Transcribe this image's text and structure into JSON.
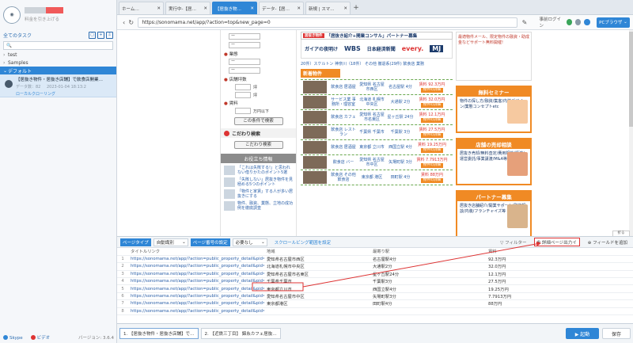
{
  "sidebar": {
    "brand_sub": "料金を引き上げる",
    "all_tasks_label": "全てのタスク",
    "folders": [
      {
        "label": "test",
        "selected": false
      },
      {
        "label": "Samples",
        "selected": false
      },
      {
        "label": "デフォルト",
        "selected": true
      }
    ],
    "task": {
      "title": "【居抜き物件・居抜き店舗】で飲食店開業…",
      "meta1": "データ数：82",
      "meta2": "2023-01-04 18:13:2",
      "status": "ローカルクローリング"
    },
    "footer": {
      "skype": "Skype",
      "video": "ビデオ",
      "version": "バージョン: 3.6.4"
    }
  },
  "tabs": [
    {
      "label": "ホーム…",
      "active": false
    },
    {
      "label": "実行中-【居…",
      "active": false
    },
    {
      "label": "【居抜き物…",
      "active": true
    },
    {
      "label": "データ-【居…",
      "active": false
    },
    {
      "label": "新規 | スマ…",
      "active": false
    }
  ],
  "toolbar": {
    "url": "https://sonomama.net/app/?action=top&new_page=0",
    "login": "事前ログイン",
    "pc_browser": "PCブラウザ"
  },
  "webpage": {
    "sel_default": "ー",
    "floor_label": "業態",
    "area_label": "店舗坪数",
    "area_unit": "坪",
    "rent_label": "賃料",
    "rent_unit": "万円以下",
    "search_btn": "この条件で検索",
    "kodawari_title": "こだわり検索",
    "kodawari_btn": "こだわり検索",
    "info_title": "お役立ち情報",
    "info_items": [
      "「これは失敗する!」と思われない借りかたのポイント5選",
      "「失敗しない」居抜き物件を見極める5つのポイント",
      "「物件と家賃」する人が多い居抜きにする",
      "物件、融資、業態、立地の成功例を徹底調査"
    ],
    "banner_tag": "居抜き物件",
    "banner_text": "「居抜き紹介+開業コンサル」パートナー募集",
    "logos": [
      "ガイアの夜明け",
      "WBS",
      "日本経済新聞",
      "every.",
      "MJ"
    ],
    "counts": "20件）スケルトン 神奈川（18件） その他 撤退系(29件) 飲食店 業務",
    "new_title": "新着物件",
    "properties": [
      {
        "genre": "飲食店 居酒屋",
        "loc": "愛知県 名古屋市西区",
        "station": "名古屋駅 4分",
        "price": "賃料 92.3万円",
        "btn": "物件の詳細"
      },
      {
        "genre": "サービス業 事務所・理容室",
        "loc": "北海道 札幌市中央区",
        "station": "大通駅 2分",
        "price": "賃料 32.0万円",
        "btn": "物件の詳細"
      },
      {
        "genre": "飲食店 カフェ",
        "loc": "愛知県 名古屋市名東区",
        "station": "星ヶ丘駅 24分",
        "price": "賃料 12.1万円",
        "btn": "物件の詳細"
      },
      {
        "genre": "飲食店 レストラン",
        "loc": "千葉県 千葉市",
        "station": "千葉駅 3分",
        "price": "賃料 27.5万円",
        "btn": "物件の詳細"
      },
      {
        "genre": "飲食店 居酒屋",
        "loc": "東京都 立川市",
        "station": "西国立駅 4分",
        "price": "賃料 19.25万円",
        "btn": "物件の詳細"
      },
      {
        "genre": "飲食店 バー",
        "loc": "愛知県 名古屋市中区",
        "station": "矢場町駅 3分",
        "price": "賃料 7.7913万円",
        "btn": "物件の詳細"
      },
      {
        "genre": "飲食店 その他飲食店",
        "loc": "東京都 港区",
        "station": "田町駅 4分",
        "price": "賃料 88万円",
        "btn": "物件の詳細"
      }
    ],
    "promo": "最適物件メール、限定物件の融資・助成金などサポート無料開催!",
    "seminar_title": "無料セミナー",
    "seminar_body": "物件の探し方/融資/集客/内装デザイン/業態コンセプトetc",
    "sell_title": "店舗の売却相談",
    "sell_body": "居抜き売却/無料査定/費用相談/譲渡/運営委託/事業譲渡/M&A等",
    "partner_title": "パートナー募集",
    "partner_body": "居抜き店舗紹介/開業サポート/融資相談/内装/フランチャイズ等",
    "fold": "折る"
  },
  "datapanel": {
    "page_type_label": "ページタイプ",
    "page_type_value": "自動識別",
    "page_count_label": "ページ番号の設定",
    "page_count_value": "必要なし",
    "scroll_link": "スクロールビング範囲を設定",
    "filter": "フィルター",
    "detail_btn": "詳細ページ出力イ",
    "add_field": "フィールドを追加",
    "columns": [
      "",
      "タイトルリンク",
      "地域",
      "最寄り駅",
      "賃料"
    ],
    "rows": [
      [
        "1",
        "https://sonomama.net/app/?action=public_property_detail&pid=57…",
        "愛知県名古屋市西区",
        "名古屋駅4分",
        "92.3万円"
      ],
      [
        "2",
        "https://sonomama.net/app/?action=public_property_detail&pid=57…",
        "北海道札幌市中央区",
        "大通駅2分",
        "32.0万円"
      ],
      [
        "3",
        "https://sonomama.net/app/?action=public_property_detail&pid=57…",
        "愛知県名古屋市名東区",
        "星ヶ丘駅24分",
        "12.1万円"
      ],
      [
        "4",
        "https://sonomama.net/app/?action=public_property_detail&pid=57…",
        "千葉県千葉市",
        "千葉駅3分",
        "27.5万円"
      ],
      [
        "5",
        "https://sonomama.net/app/?action=public_property_detail&pid=57…",
        "東京都立川市",
        "西国立駅4分",
        "19.25万円"
      ],
      [
        "6",
        "https://sonomama.net/app/?action=public_property_detail&pid=57…",
        "愛知県名古屋市中区",
        "矢場町駅3分",
        "7.7913万円"
      ],
      [
        "7",
        "https://sonomama.net/app/?action=public_property_detail&pid=57…",
        "東京都港区",
        "田町駅4分",
        "88万円"
      ],
      [
        "8",
        "https://sonomama.net/app/?action=public_property_detail&pid=57…",
        "",
        "",
        ""
      ]
    ]
  },
  "bottom": {
    "tabs": [
      "1. 【居抜き物件・居抜き店舗】で…",
      "2. 【近鉄三丁目】 錦糸カフェ居抜…"
    ],
    "start": "▶ 起動",
    "save": "保存"
  },
  "colors": {
    "accent": "#2f86d6",
    "annotation": "#d33"
  }
}
